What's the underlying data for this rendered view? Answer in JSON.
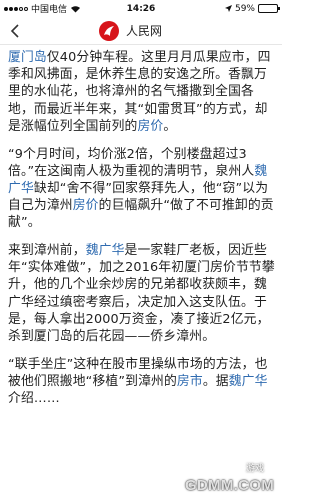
{
  "status_bar": {
    "carrier": "中国电信",
    "time": "14:26",
    "battery": "59%",
    "battery_level": 0.59
  },
  "nav": {
    "title": "人民网",
    "logo_icon": "people-daily-logo-icon",
    "back_icon": "chevron-left-icon"
  },
  "article": {
    "p1": {
      "link_1": "厦门岛",
      "text_1": "仅40分钟车程。这里月月瓜果应市，四季和风拂面，是休养生息的安逸之所。香飘万里的水仙花，也将漳州的名气播撒到全国各地，而最近半年来，其“如雷贯耳”的方式，却是涨幅位列全国前列的",
      "link_2": "房价",
      "text_2": "。"
    },
    "p2": {
      "text_1": "“9个月时间，均价涨2倍，个别楼盘超过3倍。”在这闽南人极为重视的清明节，泉州人",
      "link_1": "魏广华",
      "text_2": "缺却“舍不得”回家祭拜先人，他“窃”以为自己为漳州",
      "link_2": "房价",
      "text_3": "的巨幅飙升“做了不可推卸的贡献”。"
    },
    "p3": {
      "text_1": "来到漳州前，",
      "link_1": "魏广华",
      "text_2": "是一家鞋厂老板，因近些年“实体难做”，加之2016年初厦门房价节节攀升，他的几个业余炒房的兄弟都收获颇丰，魏广华经过缜密考察后，决定加入这支队伍。于是，每人拿出2000万资金，凑了接近2亿元，杀到厦门岛的后花园——侨乡漳州。"
    },
    "p4": {
      "text_1": "“联手坐庄”这种在股市里操纵市场的方法，也被他们照搬地“移植”到漳州的",
      "link_1": "房市",
      "text_2": "。据",
      "link_2": "魏广华",
      "text_3": "介绍……"
    }
  },
  "watermark": {
    "top": "游戏",
    "text": "GDMM.COM"
  },
  "colors": {
    "link": "#2f6bb0",
    "logo_red": "#d7141a"
  }
}
